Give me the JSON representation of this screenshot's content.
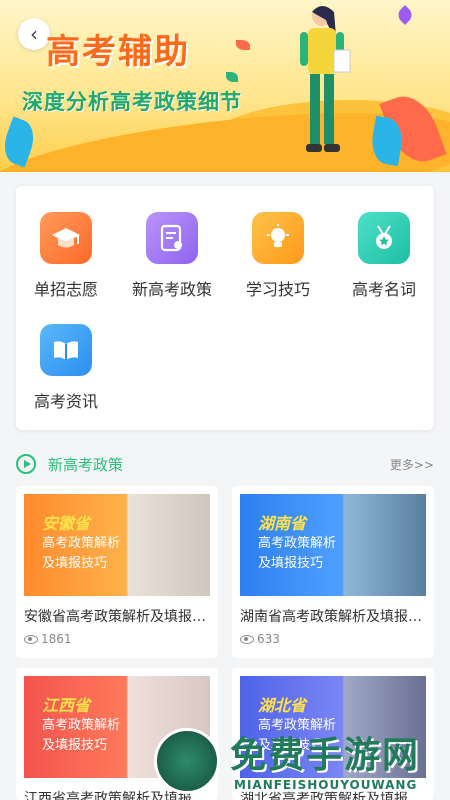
{
  "banner": {
    "back_icon": "chevron-left-icon",
    "title": "高考辅助",
    "subtitle": "深度分析高考政策细节"
  },
  "quick_menu": [
    {
      "label": "单招志愿",
      "icon": "graduation-cap-icon",
      "color": "#ff7b3a"
    },
    {
      "label": "新高考政策",
      "icon": "document-icon",
      "color": "#a57cf5"
    },
    {
      "label": "学习技巧",
      "icon": "lightbulb-icon",
      "color": "#ffac2b"
    },
    {
      "label": "高考名词",
      "icon": "medal-icon",
      "color": "#2ccfb4"
    },
    {
      "label": "高考资讯",
      "icon": "book-icon",
      "color": "#3ba3f5"
    }
  ],
  "section": {
    "icon": "play-circle-icon",
    "title": "新高考政策",
    "more": "更多>>"
  },
  "news": [
    {
      "province": "安徽省",
      "line1": "高考政策解析",
      "line2": "及填报技巧",
      "title": "安徽省高考政策解析及填报技巧",
      "views": "1861",
      "theme": "#ff8a2e"
    },
    {
      "province": "湖南省",
      "line1": "高考政策解析",
      "line2": "及填报技巧",
      "title": "湖南省高考政策解析及填报技巧",
      "views": "633",
      "theme": "#2e7ff0"
    },
    {
      "province": "江西省",
      "line1": "高考政策解析",
      "line2": "及填报技巧",
      "title": "江西省高考政策解析及填报技巧",
      "views": "",
      "theme": "#f2544e"
    },
    {
      "province": "湖北省",
      "line1": "高考政策解析",
      "line2": "及填报技巧",
      "title": "湖北省高考政策解析及填报技巧",
      "views": "",
      "theme": "#4f63e8"
    }
  ],
  "watermark": {
    "text": "免费手游网",
    "sub": "MIANFEISHOUYOUWANG"
  }
}
